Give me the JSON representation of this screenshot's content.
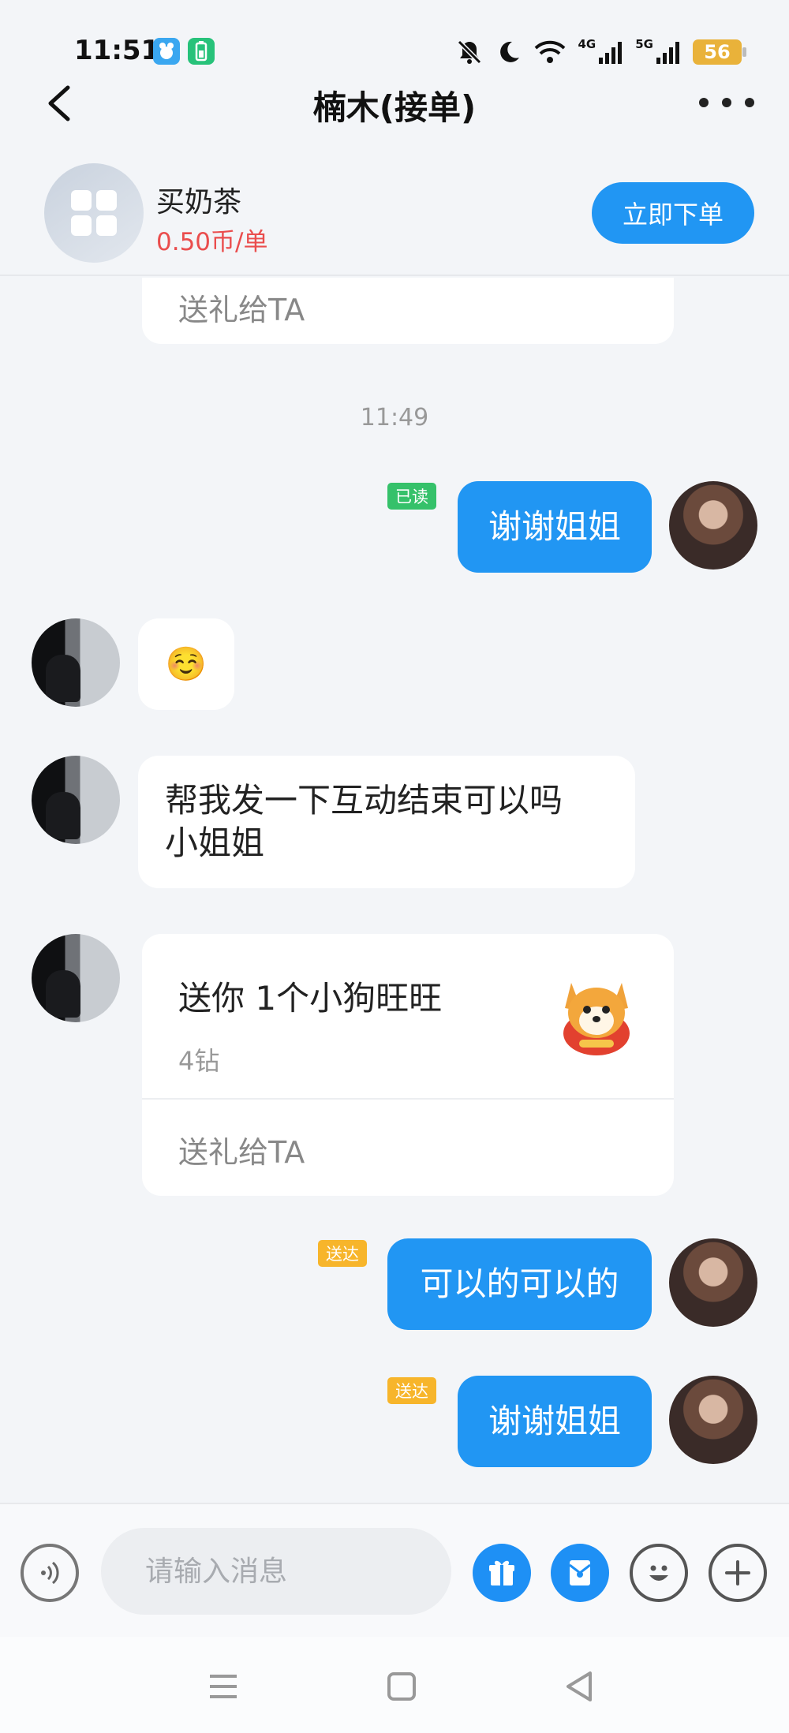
{
  "status_bar": {
    "time": "11:51",
    "net_4g": "4G",
    "net_5g": "5G",
    "battery": "56"
  },
  "nav": {
    "title": "楠木(接单)"
  },
  "service": {
    "name": "买奶茶",
    "price": "0.50币/单",
    "order_button": "立即下单"
  },
  "chat": {
    "partial_gift_footer": "送礼给TA",
    "timestamp": "11:49",
    "messages": [
      {
        "from": "me",
        "text": "谢谢姐姐",
        "status": "已读"
      },
      {
        "from": "other",
        "text": "☺️"
      },
      {
        "from": "other",
        "text": "帮我发一下互动结束可以吗\n小姐姐"
      },
      {
        "from": "other",
        "type": "gift",
        "title": "送你 1个小狗旺旺",
        "price": "4钻",
        "footer": "送礼给TA"
      },
      {
        "from": "me",
        "text": "可以的可以的",
        "status": "送达"
      },
      {
        "from": "me",
        "text": "谢谢姐姐",
        "status": "送达"
      }
    ]
  },
  "input_bar": {
    "placeholder": "请输入消息"
  },
  "colors": {
    "accent": "#2196f3",
    "price": "#ea4d4d",
    "read_tag": "#35c16a",
    "delivered_tag": "#f7b52b"
  }
}
